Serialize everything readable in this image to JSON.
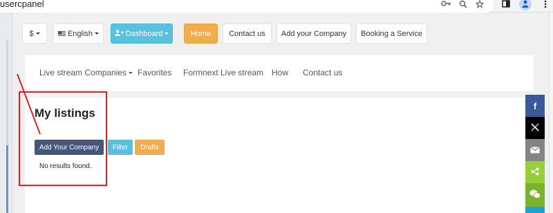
{
  "browser": {
    "url_fragment": "usercpanel",
    "icons": [
      "key-icon",
      "zoom-icon",
      "star-icon",
      "sidepanel-icon",
      "profile-icon",
      "more-icon"
    ]
  },
  "top_nav": {
    "currency_label": "$",
    "language_label": "English",
    "dashboard_label": "Dashboard",
    "home_label": "Home",
    "contact_label": "Contact us",
    "add_company_label": "Add your Company",
    "booking_label": "Booking a Service"
  },
  "sub_nav": {
    "items": [
      "Live stream Companies",
      "Favorites",
      "Formnext Live stream",
      "How",
      "Contact us"
    ]
  },
  "main": {
    "title": "My listings",
    "add_button_label": "Add Your Company",
    "filter_button_label": "Filter",
    "drafts_button_label": "Drafts",
    "empty_message": "No results found."
  },
  "share_bar": {
    "facebook_glyph": "f",
    "x_glyph": "𝕏",
    "mail_glyph": "✉",
    "share_glyph": "<",
    "wechat_glyph": "●"
  },
  "colors": {
    "home_orange": "#f0ad4e",
    "dashboard_cyan": "#5bc0de",
    "add_company_navy": "#44577a",
    "annotation_red": "#e02020"
  }
}
